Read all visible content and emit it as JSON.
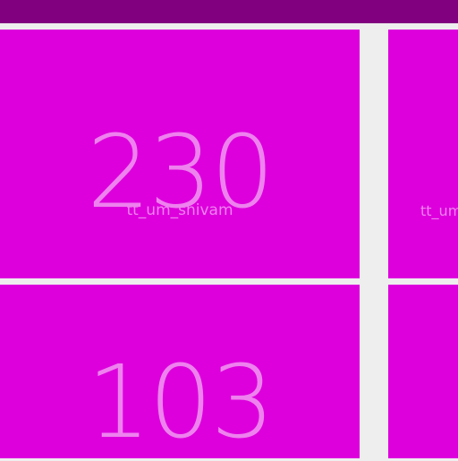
{
  "header": {
    "color": "#800080"
  },
  "tile_color": "#dd00dd",
  "text_color": "#ee82ee",
  "tiles": [
    {
      "value": "230",
      "label": "tt_um_shivam"
    },
    {
      "value": "",
      "label": "tt_um"
    },
    {
      "value": "103",
      "label": ""
    },
    {
      "value": "",
      "label": ""
    }
  ]
}
